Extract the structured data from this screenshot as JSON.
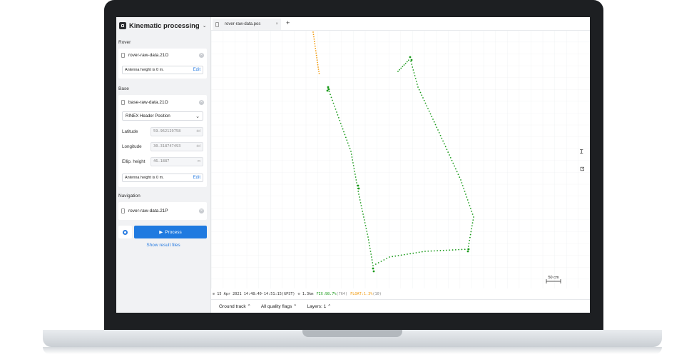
{
  "app": {
    "title": "Kinematic processing"
  },
  "sidebar": {
    "rover": {
      "label": "Rover",
      "file": "rover-raw-data.21O",
      "antenna_text": "Antenna height is 0 m.",
      "edit_label": "Edit"
    },
    "base": {
      "label": "Base",
      "file": "base-raw-data.21O",
      "position_source": "RINEX Header Position",
      "fields": [
        {
          "label": "Latitude",
          "value": "59.962129758",
          "unit": "dd"
        },
        {
          "label": "Longitude",
          "value": "30.318747493",
          "unit": "dd"
        },
        {
          "label": "Ellip. height",
          "value": "46.1887",
          "unit": "m"
        }
      ],
      "antenna_text": "Antenna height is 0 m.",
      "edit_label": "Edit"
    },
    "navigation": {
      "label": "Navigation",
      "file": "rover-raw-data.21P"
    },
    "process_label": "Process",
    "show_results_label": "Show result files"
  },
  "tabs": [
    {
      "label": "rover-raw-data.pos"
    }
  ],
  "tab_add": "+",
  "map": {
    "scale_label": "50 cm",
    "colors": {
      "fix": "#1a9a1a",
      "float": "#f29a0c"
    }
  },
  "statusbar": {
    "time_range": "15 Apr 2021 14:48:40-14:51:15(GPST)",
    "distance": "1.3km",
    "fix": "FIX:98.7%",
    "fix_count": "(764)",
    "float": "FLOAT:1.3%",
    "float_count": "(10)"
  },
  "bottom_menu": [
    {
      "label": "Ground track"
    },
    {
      "label": "All quality flags"
    },
    {
      "label": "Layers: 1"
    }
  ],
  "icons": {
    "cursor": "text-cursor-icon",
    "fit": "fit-view-icon"
  }
}
